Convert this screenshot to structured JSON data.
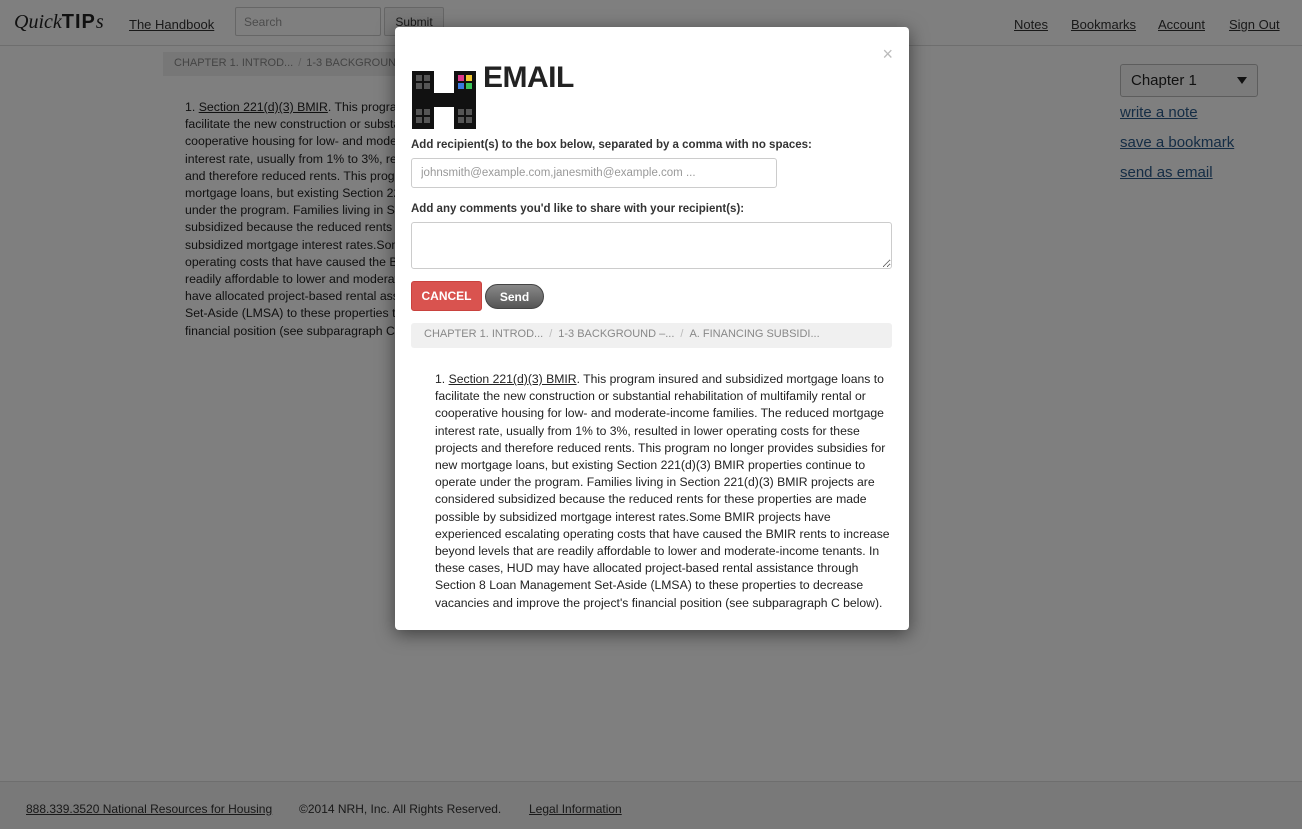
{
  "header": {
    "logo_text_1": "Quick",
    "logo_text_2": "TIP",
    "logo_text_3": "s",
    "handbook_link": "The Handbook",
    "search_placeholder": "Search",
    "submit_label": "Submit",
    "nav": [
      "Notes",
      "Bookmarks",
      "Account",
      "Sign Out"
    ]
  },
  "breadcrumb": [
    "CHAPTER 1. INTROD...",
    "1-3 BACKGROUND –...",
    "A. FINANCING SUBSIDI..."
  ],
  "background_content": {
    "number": "1.",
    "link": "Section 221(d)(3) BMIR",
    "text": "This program insured and subsidized mortgage loans to facilitate the new construction or substantial rehabilitation of multifamily rental or cooperative housing for low- and moderate-income families. The reduced mortgage interest rate, usually from 1% to 3%, resulted in lower operating costs for these projects and therefore reduced rents. This program no longer provides subsidies for new mortgage loans, but existing Section 221(d)(3) BMIR properties continue to operate under the program. Families living in Section 221(d)(3) BMIR projects are considered subsidized because the reduced rents for these properties are made possible by subsidized mortgage interest rates.Some BMIR projects have experienced escalating operating costs that have caused the BMIR rents to increase beyond levels that are readily affordable to lower and moderate-income tenants. In these cases, HUD may have allocated project-based rental assistance through Section 8 Loan Management Set-Aside (LMSA) to these properties to decrease vacancies and improve the project's financial position (see subparagraph C below)."
  },
  "sidebar": {
    "chapter_select": "Chapter 1",
    "links": [
      "write a note",
      "save a bookmark",
      "send as email"
    ]
  },
  "footer": {
    "phone": "888.339.3520 National Resources for Housing",
    "copyright": "©2014 NRH, Inc. All Rights Reserved.",
    "legal": "Legal Information"
  },
  "modal": {
    "close": "×",
    "title": "EMAIL",
    "recipients_label": "Add recipient(s) to the box below, separated by a comma with no spaces:",
    "recipients_placeholder": "johnsmith@example.com,janesmith@example.com ...",
    "comments_label": "Add any comments you'd like to share with your recipient(s):",
    "cancel_label": "CANCEL",
    "send_label": "Send"
  },
  "colors": {
    "cancel": "#d9534f",
    "link": "#2a5a8a",
    "overlay": "rgba(0,0,0,0.5)"
  }
}
